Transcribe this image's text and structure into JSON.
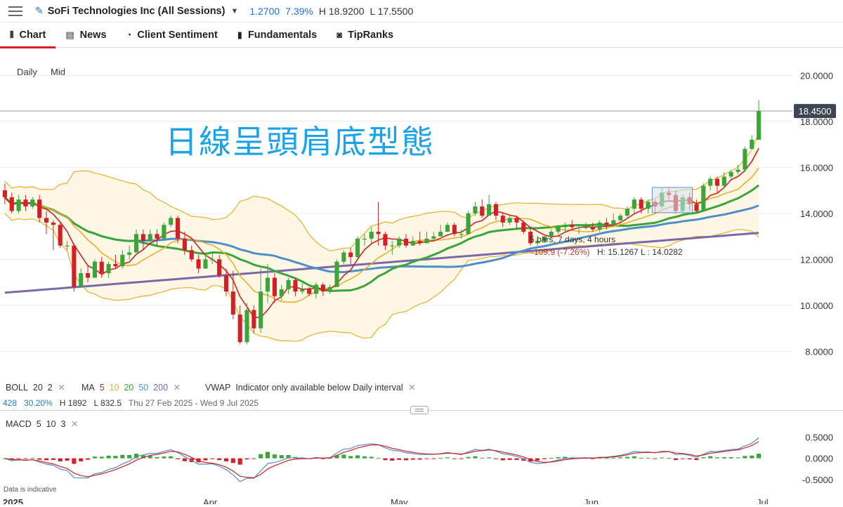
{
  "header": {
    "instrument": "SoFi Technologies Inc (All Sessions)",
    "change": "1.2700",
    "change_pct": "7.39%",
    "high": "H 18.9200",
    "low": "L 17.5500"
  },
  "tabs": [
    {
      "label": "Chart",
      "icon": "candle-icon"
    },
    {
      "label": "News",
      "icon": "newspaper-icon"
    },
    {
      "label": "Client Sentiment",
      "icon": "sentiment-icon"
    },
    {
      "label": "Fundamentals",
      "icon": "bars-icon"
    },
    {
      "label": "TipRanks",
      "icon": "tipranks-icon"
    }
  ],
  "period": {
    "interval": "Daily",
    "price_type": "Mid"
  },
  "overlay_text": "日線呈頭肩底型態",
  "measure_tool": {
    "line1": "5 bars, 7 days, 4 hours",
    "line2": "-109.9 (-7.26%)",
    "line3": "H: 15.1267 L : 14.0282"
  },
  "indicators": {
    "boll": {
      "name": "BOLL",
      "p1": "20",
      "p2": "2"
    },
    "ma": {
      "name": "MA",
      "periods": [
        "5",
        "10",
        "20",
        "50",
        "200"
      ]
    },
    "vwap": {
      "name": "VWAP",
      "note": "Indicator only available below Daily interval"
    },
    "macd": {
      "name": "MACD",
      "p1": "5",
      "p2": "10",
      "p3": "3"
    }
  },
  "range_info": {
    "value1": "428",
    "value2": "30.20%",
    "high": "H 1892",
    "low": "L 832.5",
    "dates": "Thu 27 Feb 2025 - Wed 9 Jul 2025"
  },
  "disclaimer": "Data is indicative",
  "colors": {
    "up": "#3aa63a",
    "down": "#d32027",
    "ma5": "#d32027",
    "ma10": "#e8b027",
    "ma20": "#3aa63a",
    "ma50": "#4f8fc9",
    "ma200": "#7b68a6",
    "boll": "#e8b027",
    "overlay": "#1aa3e8",
    "accent": "#1a73e8"
  },
  "chart_data": {
    "type": "candlestick",
    "title": "",
    "ylim": [
      7.4,
      21.2
    ],
    "y_ticks": [
      "20.0000",
      "18.0000",
      "16.0000",
      "14.0000",
      "12.0000",
      "10.0000",
      "8.0000"
    ],
    "current_price": "18.4500",
    "x_ticks": [
      "2025",
      "Apr",
      "May",
      "Jun",
      "Jul"
    ],
    "candles": [
      [
        15.0,
        14.7,
        15.3,
        14.4
      ],
      [
        14.7,
        14.1,
        14.9,
        14.0
      ],
      [
        14.1,
        14.6,
        14.8,
        14.0
      ],
      [
        14.6,
        14.3,
        14.8,
        14.1
      ],
      [
        14.3,
        14.6,
        14.7,
        14.2
      ],
      [
        14.6,
        13.8,
        14.8,
        13.6
      ],
      [
        13.8,
        13.6,
        14.1,
        13.1
      ],
      [
        13.6,
        13.5,
        13.7,
        12.4
      ],
      [
        13.5,
        12.6,
        13.6,
        12.5
      ],
      [
        12.6,
        12.6,
        12.8,
        12.4
      ],
      [
        12.6,
        10.8,
        12.7,
        10.6
      ],
      [
        10.8,
        11.4,
        11.6,
        10.8
      ],
      [
        11.4,
        11.2,
        11.7,
        11.0
      ],
      [
        11.2,
        11.9,
        12.0,
        11.2
      ],
      [
        11.9,
        11.4,
        12.1,
        11.2
      ],
      [
        11.4,
        11.8,
        11.9,
        11.2
      ],
      [
        11.8,
        11.7,
        12.2,
        11.6
      ],
      [
        11.7,
        12.2,
        12.4,
        11.6
      ],
      [
        12.2,
        12.3,
        12.6,
        12.0
      ],
      [
        12.3,
        13.1,
        13.3,
        12.3
      ],
      [
        13.1,
        12.8,
        13.3,
        12.4
      ],
      [
        12.8,
        13.1,
        13.3,
        12.7
      ],
      [
        13.1,
        12.9,
        13.3,
        12.6
      ],
      [
        12.9,
        13.5,
        13.6,
        12.9
      ],
      [
        13.5,
        13.8,
        13.9,
        13.4
      ],
      [
        13.8,
        12.9,
        13.9,
        12.7
      ],
      [
        12.9,
        12.4,
        13.2,
        12.2
      ],
      [
        12.4,
        12.0,
        12.6,
        11.9
      ],
      [
        12.0,
        11.6,
        12.2,
        11.4
      ],
      [
        11.6,
        12.0,
        12.3,
        11.6
      ],
      [
        12.0,
        12.0,
        12.3,
        11.8
      ],
      [
        12.0,
        11.3,
        12.2,
        11.2
      ],
      [
        11.3,
        10.6,
        11.6,
        10.4
      ],
      [
        10.6,
        9.6,
        11.5,
        9.4
      ],
      [
        9.6,
        8.4,
        10.0,
        8.3
      ],
      [
        8.4,
        9.8,
        10.1,
        8.3
      ],
      [
        9.8,
        9.0,
        10.0,
        8.8
      ],
      [
        9.0,
        10.6,
        11.6,
        8.8
      ],
      [
        10.6,
        11.2,
        11.8,
        10.1
      ],
      [
        11.2,
        10.4,
        11.4,
        10.1
      ],
      [
        10.4,
        10.7,
        10.9,
        10.2
      ],
      [
        10.7,
        11.1,
        11.2,
        10.5
      ],
      [
        11.1,
        10.6,
        11.2,
        10.4
      ],
      [
        10.6,
        10.7,
        11.0,
        10.5
      ],
      [
        10.7,
        10.5,
        10.8,
        10.4
      ],
      [
        10.5,
        10.9,
        11.0,
        10.3
      ],
      [
        10.9,
        10.6,
        11.0,
        10.4
      ],
      [
        10.6,
        10.8,
        10.9,
        10.5
      ],
      [
        10.8,
        11.9,
        12.0,
        10.8
      ],
      [
        11.9,
        12.3,
        12.4,
        11.8
      ],
      [
        12.3,
        12.1,
        12.5,
        11.8
      ],
      [
        12.1,
        12.9,
        13.0,
        12.0
      ],
      [
        12.9,
        12.9,
        13.1,
        12.6
      ],
      [
        12.9,
        13.2,
        13.4,
        12.7
      ],
      [
        13.2,
        13.1,
        14.5,
        12.6
      ],
      [
        13.1,
        12.6,
        13.2,
        12.4
      ],
      [
        12.6,
        12.6,
        12.8,
        12.2
      ],
      [
        12.6,
        12.9,
        13.0,
        12.5
      ],
      [
        12.9,
        12.6,
        13.1,
        12.5
      ],
      [
        12.6,
        12.8,
        13.0,
        12.6
      ],
      [
        12.8,
        12.7,
        13.2,
        12.6
      ],
      [
        12.7,
        12.9,
        13.2,
        12.7
      ],
      [
        12.9,
        13.0,
        13.2,
        12.8
      ],
      [
        13.0,
        13.2,
        13.5,
        13.0
      ],
      [
        13.2,
        13.5,
        13.6,
        13.2
      ],
      [
        13.5,
        13.1,
        13.6,
        13.0
      ],
      [
        13.1,
        13.1,
        13.3,
        12.9
      ],
      [
        13.1,
        14.0,
        14.1,
        13.1
      ],
      [
        14.0,
        14.3,
        14.5,
        13.9
      ],
      [
        14.3,
        13.9,
        14.6,
        13.8
      ],
      [
        13.9,
        14.4,
        14.8,
        13.9
      ],
      [
        14.4,
        13.9,
        14.5,
        13.7
      ],
      [
        13.9,
        13.6,
        14.0,
        13.4
      ],
      [
        13.6,
        13.8,
        13.9,
        13.5
      ],
      [
        13.8,
        13.6,
        13.9,
        13.3
      ],
      [
        13.6,
        13.2,
        13.7,
        13.1
      ],
      [
        13.2,
        12.7,
        13.4,
        12.6
      ],
      [
        12.7,
        12.8,
        12.9,
        12.6
      ],
      [
        12.8,
        13.0,
        13.0,
        12.7
      ],
      [
        13.0,
        13.2,
        13.3,
        12.9
      ],
      [
        13.2,
        13.4,
        13.5,
        13.1
      ],
      [
        13.4,
        13.5,
        13.6,
        13.2
      ],
      [
        13.5,
        13.4,
        13.7,
        13.3
      ],
      [
        13.4,
        13.4,
        13.5,
        13.1
      ],
      [
        13.4,
        13.4,
        13.6,
        13.3
      ],
      [
        13.4,
        13.3,
        13.6,
        13.2
      ],
      [
        13.3,
        13.6,
        13.7,
        13.2
      ],
      [
        13.6,
        13.5,
        13.8,
        13.3
      ],
      [
        13.5,
        13.7,
        14.0,
        13.4
      ],
      [
        13.7,
        13.9,
        14.0,
        13.4
      ],
      [
        13.9,
        14.2,
        14.3,
        13.8
      ],
      [
        14.2,
        14.6,
        14.7,
        14.0
      ],
      [
        14.6,
        14.2,
        14.7,
        14.0
      ],
      [
        14.2,
        14.5,
        14.6,
        14.0
      ],
      [
        14.5,
        14.3,
        14.6,
        14.0
      ],
      [
        14.3,
        14.9,
        15.1,
        14.2
      ],
      [
        14.9,
        14.8,
        15.1,
        14.6
      ],
      [
        14.8,
        14.1,
        15.0,
        14.0
      ],
      [
        14.1,
        14.7,
        14.8,
        14.0
      ],
      [
        14.7,
        14.4,
        14.9,
        14.1
      ],
      [
        14.4,
        14.1,
        14.6,
        14.0
      ],
      [
        14.1,
        15.2,
        15.3,
        14.1
      ],
      [
        15.2,
        15.5,
        15.6,
        15.0
      ],
      [
        15.5,
        15.2,
        15.6,
        14.9
      ],
      [
        15.2,
        15.6,
        15.8,
        15.1
      ],
      [
        15.6,
        15.8,
        15.9,
        15.5
      ],
      [
        15.8,
        15.9,
        16.1,
        15.7
      ],
      [
        15.9,
        16.8,
        16.9,
        15.8
      ],
      [
        16.8,
        17.2,
        17.4,
        16.9
      ],
      [
        17.2,
        18.45,
        18.92,
        17.2
      ]
    ],
    "macd_ylim": [
      -0.78,
      0.95
    ],
    "macd_ticks": [
      "0.5000",
      "0.0000",
      "-0.5000"
    ]
  }
}
